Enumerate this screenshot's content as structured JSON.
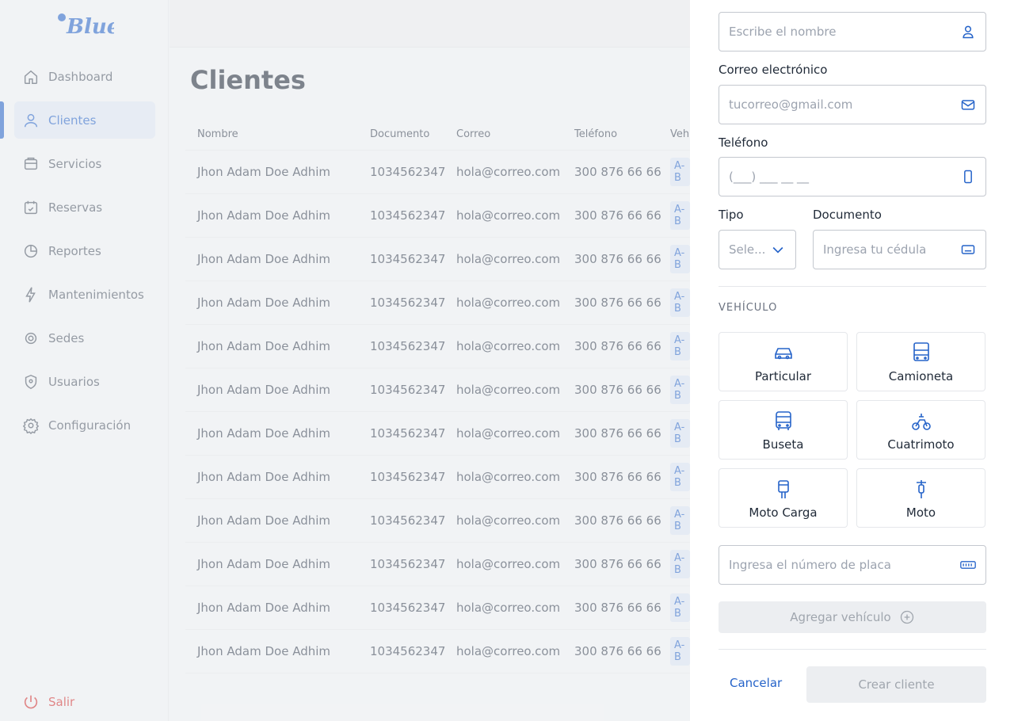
{
  "brand": {
    "logo_text": "Blue"
  },
  "sidebar": {
    "items": [
      {
        "label": "Dashboard",
        "icon": "home-icon"
      },
      {
        "label": "Clientes",
        "icon": "user-icon"
      },
      {
        "label": "Servicios",
        "icon": "services-icon"
      },
      {
        "label": "Reservas",
        "icon": "calendar-icon"
      },
      {
        "label": "Reportes",
        "icon": "chart-icon"
      },
      {
        "label": "Mantenimientos",
        "icon": "bolt-icon"
      },
      {
        "label": "Sedes",
        "icon": "location-icon"
      },
      {
        "label": "Usuarios",
        "icon": "shield-icon"
      },
      {
        "label": "Configuración",
        "icon": "gear-icon"
      }
    ],
    "active": "Clientes",
    "logout_label": "Salir"
  },
  "main": {
    "title": "Clientes",
    "columns": [
      "Nombre",
      "Documento",
      "Correo",
      "Teléfono",
      "Vehí"
    ],
    "rows": [
      [
        "Jhon Adam Doe Adhim",
        "1034562347",
        "hola@correo.com",
        "300 876 66 66",
        "A-B"
      ],
      [
        "Jhon Adam Doe Adhim",
        "1034562347",
        "hola@correo.com",
        "300 876 66 66",
        "A-B"
      ],
      [
        "Jhon Adam Doe Adhim",
        "1034562347",
        "hola@correo.com",
        "300 876 66 66",
        "A-B"
      ],
      [
        "Jhon Adam Doe Adhim",
        "1034562347",
        "hola@correo.com",
        "300 876 66 66",
        "A-B"
      ],
      [
        "Jhon Adam Doe Adhim",
        "1034562347",
        "hola@correo.com",
        "300 876 66 66",
        "A-B"
      ],
      [
        "Jhon Adam Doe Adhim",
        "1034562347",
        "hola@correo.com",
        "300 876 66 66",
        "A-B"
      ],
      [
        "Jhon Adam Doe Adhim",
        "1034562347",
        "hola@correo.com",
        "300 876 66 66",
        "A-B"
      ],
      [
        "Jhon Adam Doe Adhim",
        "1034562347",
        "hola@correo.com",
        "300 876 66 66",
        "A-B"
      ],
      [
        "Jhon Adam Doe Adhim",
        "1034562347",
        "hola@correo.com",
        "300 876 66 66",
        "A-B"
      ],
      [
        "Jhon Adam Doe Adhim",
        "1034562347",
        "hola@correo.com",
        "300 876 66 66",
        "A-B"
      ],
      [
        "Jhon Adam Doe Adhim",
        "1034562347",
        "hola@correo.com",
        "300 876 66 66",
        "A-B"
      ],
      [
        "Jhon Adam Doe Adhim",
        "1034562347",
        "hola@correo.com",
        "300 876 66 66",
        "A-B"
      ]
    ]
  },
  "panel": {
    "name_placeholder": "Escribe el nombre",
    "email_label": "Correo electrónico",
    "email_placeholder": "tucorreo@gmail.com",
    "phone_label": "Teléfono",
    "phone_placeholder": "(___) ___ __ __",
    "type_label": "Tipo",
    "type_placeholder": "Sele...",
    "doc_label": "Documento",
    "doc_placeholder": "Ingresa tu cédula",
    "vehicle_section": "VEHÍCULO",
    "vehicle_types": [
      "Particular",
      "Camioneta",
      "Buseta",
      "Cuatrimoto",
      "Moto Carga",
      "Moto"
    ],
    "plate_placeholder": "Ingresa el número de placa",
    "add_vehicle_label": "Agregar vehículo",
    "cancel_label": "Cancelar",
    "create_label": "Crear cliente"
  },
  "colors": {
    "accent": "#2563c9",
    "danger": "#d32f2f"
  }
}
